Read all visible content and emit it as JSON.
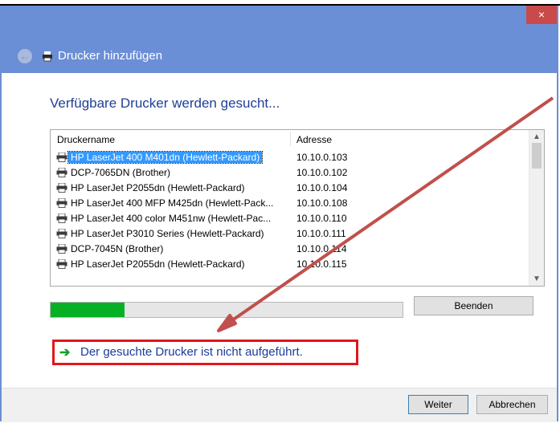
{
  "window": {
    "close_glyph": "×"
  },
  "nav": {
    "title": "Drucker hinzufügen",
    "back_glyph": "←"
  },
  "heading": "Verfügbare Drucker werden gesucht...",
  "list": {
    "columns": [
      "Druckername",
      "Adresse"
    ],
    "rows": [
      {
        "name": "HP LaserJet 400 M401dn (Hewlett-Packard)",
        "address": "10.10.0.103",
        "selected": true
      },
      {
        "name": "DCP-7065DN (Brother)",
        "address": "10.10.0.102"
      },
      {
        "name": "HP LaserJet P2055dn (Hewlett-Packard)",
        "address": "10.10.0.104"
      },
      {
        "name": "HP LaserJet 400 MFP M425dn (Hewlett-Pack...",
        "address": "10.10.0.108"
      },
      {
        "name": "HP LaserJet 400 color M451nw (Hewlett-Pac...",
        "address": "10.10.0.110"
      },
      {
        "name": "HP LaserJet P3010 Series (Hewlett-Packard)",
        "address": "10.10.0.111"
      },
      {
        "name": "DCP-7045N (Brother)",
        "address": "10.10.0.114"
      },
      {
        "name": "HP LaserJet P2055dn (Hewlett-Packard)",
        "address": "10.10.0.115"
      }
    ],
    "scroll_up": "▲",
    "scroll_down": "▼"
  },
  "progress": {
    "fraction": 0.21,
    "color": "#06b025"
  },
  "buttons": {
    "stop": "Beenden",
    "next": "Weiter",
    "cancel": "Abbrechen"
  },
  "link": {
    "arrow": "➔",
    "text": "Der gesuchte Drucker ist nicht aufgeführt."
  },
  "colors": {
    "accent": "#6b8fd6",
    "highlight": "#e3161d",
    "link": "#1a3b9b"
  },
  "icons": {
    "back": "back-arrow-icon",
    "printer": "printer-icon",
    "close": "close-icon"
  }
}
